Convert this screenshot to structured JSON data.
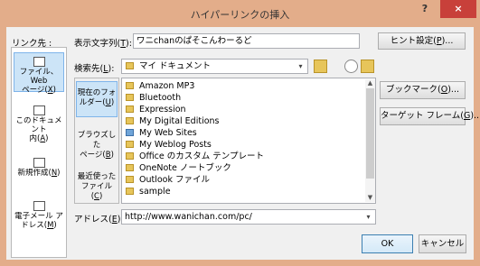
{
  "window": {
    "title": "ハイパーリンクの挿入",
    "help_label": "?",
    "close_label": "×"
  },
  "header": {
    "link_to_label": "リンク先 :",
    "display_text_label": "表示文字列(",
    "display_text_key": "T",
    "display_text_suffix": "):",
    "display_text_value": "ワニchanのぱそこんわーるど",
    "hint_btn_prefix": "ヒント設定(",
    "hint_btn_key": "P",
    "hint_btn_suffix": ")..."
  },
  "left_panel": {
    "items": [
      {
        "line1": "ファイル、Web",
        "line2": "ページ(",
        "key": "X",
        "suffix": ")",
        "icon": "web-page-icon"
      },
      {
        "line1": "このドキュメント",
        "line2": "内(",
        "key": "A",
        "suffix": ")",
        "icon": "document-icon"
      },
      {
        "line1": "新規作成(",
        "line2": "",
        "key": "N",
        "suffix": ")",
        "icon": "new-doc-icon"
      },
      {
        "line1": "電子メール ア",
        "line2": "ドレス(",
        "key": "M",
        "suffix": ")",
        "icon": "email-icon"
      }
    ]
  },
  "lookin": {
    "label_prefix": "検索先(",
    "label_key": "L",
    "label_suffix": "):",
    "value": "マイ ドキュメント"
  },
  "inner_panel": {
    "items": [
      {
        "line1": "現在のフォ",
        "line2": "ルダー(",
        "key": "U",
        "suffix": ")"
      },
      {
        "line1": "ブラウズした",
        "line2": "ページ(",
        "key": "B",
        "suffix": ")"
      },
      {
        "line1": "最近使った",
        "line2": "ファイル(",
        "key": "C",
        "suffix": ")"
      }
    ]
  },
  "file_list": [
    {
      "name": "Amazon MP3",
      "icon": "folder"
    },
    {
      "name": "Bluetooth",
      "icon": "folder"
    },
    {
      "name": "Expression",
      "icon": "folder"
    },
    {
      "name": "My Digital Editions",
      "icon": "folder"
    },
    {
      "name": "My Web Sites",
      "icon": "folder-blue"
    },
    {
      "name": "My Weblog Posts",
      "icon": "folder"
    },
    {
      "name": "Office のカスタム テンプレート",
      "icon": "folder"
    },
    {
      "name": "OneNote ノートブック",
      "icon": "folder"
    },
    {
      "name": "Outlook ファイル",
      "icon": "folder"
    },
    {
      "name": "sample",
      "icon": "folder"
    }
  ],
  "right_buttons": {
    "bookmark_prefix": "ブックマーク(",
    "bookmark_key": "O",
    "bookmark_suffix": ")...",
    "target_prefix": "ターゲット フレーム(",
    "target_key": "G",
    "target_suffix": ")..."
  },
  "address": {
    "label_prefix": "アドレス(",
    "label_key": "E",
    "label_suffix": "):",
    "value": "http://www.wanichan.com/pc/"
  },
  "footer": {
    "ok_label": "OK",
    "cancel_label": "キャンセル"
  },
  "colors": {
    "title_bar": "#e3ad8a",
    "close_button": "#c8403a",
    "selection": "#cce4f7"
  }
}
